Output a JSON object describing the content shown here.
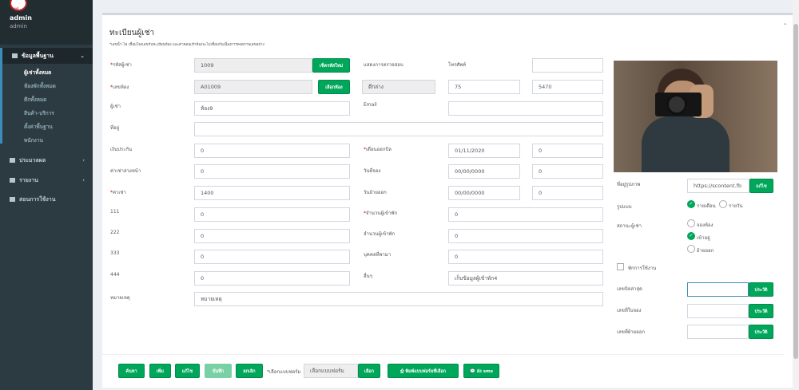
{
  "sidebar": {
    "logo_text": "บุษย์",
    "user_name": "admin",
    "user_role": "admin",
    "menu": {
      "basic": "ข้อมูลพื้นฐาน",
      "process": "ประมวลผล",
      "report": "รายงาน",
      "manual": "สอนการใช้งาน"
    },
    "submenu": [
      "ผู้เช่าทั้งหมด",
      "ห้องพักทั้งหมด",
      "ตึกทั้งหมด",
      "สินค้า-บริการ",
      "ตั้งค่าพื้นฐาน",
      "พนักงาน"
    ]
  },
  "form": {
    "title": "ทะเบียนผู้เช่า",
    "subtitle": "*เลขน้ำ-ไฟ เชื่อมโยงเลขกับทะเบียนห้อง และค่าตอนเข้าห้องจะไม่เชื่อมกันเนื่องการคงสภาพเลขอย่าง",
    "labels": {
      "code": "รหัสผู้เช่า",
      "room": "เลขห้อง",
      "tenant": "ผู้เช่า",
      "address": "ที่อยู่",
      "deposit": "เงินประกัน",
      "advance": "ค่าเช่าล่วงหน้า",
      "rent": "ค่าเช่า",
      "f111": "111",
      "f222": "222",
      "f333": "333",
      "f444": "444",
      "note": "หมายเหตุ",
      "doc": "แสดงการตรวจสอบ",
      "phone": "โทรศัพท์",
      "building": "ตึกล่าง",
      "email": "Email",
      "bill_month": "เดือนออกบิล",
      "book_date": "วันที่จอง",
      "out_date": "วันย้ายออก",
      "residents": "จำนวนผู้เข้าพัก",
      "residents2": "จำนวนผู้เข้าพัก",
      "refer": "บุคคลที่พามา",
      "other": "อื่นๆ"
    },
    "values": {
      "code": "1009",
      "room": "A01009",
      "tenant": "ห้อง9",
      "address": "",
      "deposit": "0",
      "advance": "0",
      "rent": "1400",
      "f111": "0",
      "f222": "0",
      "f333": "0",
      "f444": "0",
      "note": "หมายเหตุ",
      "phone": "",
      "building": "ตึกล่าง",
      "meter1": "75",
      "meter2": "5470",
      "email": "",
      "bill_month": "01/11/2020",
      "bill_month_n": "0",
      "book_date": "00/00/0000",
      "book_date_n": "0",
      "out_date": "00/00/0000",
      "out_date_n": "0",
      "residents": "0",
      "residents2": "0",
      "refer": "0",
      "other": "เก็บข้อมูลผู้เข้าพัก4"
    },
    "buttons": {
      "new_code": "เช็ครหัสใหม่",
      "pick_room": "เลือกห้อง"
    }
  },
  "side": {
    "photo_label": "ที่อยู่รูปภาพ",
    "photo_url": "https://scontent.fb",
    "edit": "แก้ไข",
    "type_label": "รูปแบบ",
    "type_month": "รายเดือน",
    "type_day": "รายวัน",
    "status_label": "สถานะผู้เช่า",
    "status_book": "จองห้อง",
    "status_in": "เข้าอยู่",
    "status_out": "ย้ายออก",
    "stop_use": "พักการใช้งาน",
    "recent_bill": "เลขบิลล่าสุด",
    "book_no": "เลขที่ใบจอง",
    "out_no": "เลขที่ย้ายออก",
    "history": "ประวัติ"
  },
  "footer": {
    "search": "ค้นหา",
    "add": "เพิ่ม",
    "edit": "แก้ไข",
    "save": "บันทึก",
    "cancel": "ยกเลิก",
    "form_label": "*เลือกแบบฟอร์ม",
    "form_placeholder": "เลือกแบบฟอร์ม",
    "pick": "เลือก",
    "print": "พิมพ์แบบฟอร์มที่เลือก",
    "sms": "ส่ง sms"
  }
}
